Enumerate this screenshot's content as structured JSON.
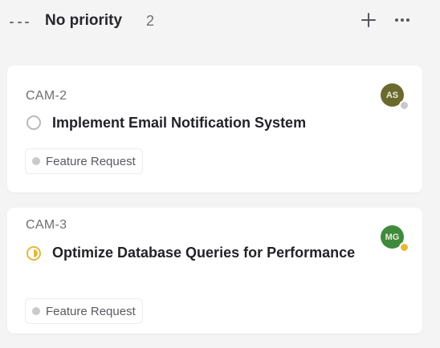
{
  "column": {
    "title": "No priority",
    "count": "2",
    "header_icon": "no-priority-icon",
    "actions": {
      "add_icon": "plus-icon",
      "more_icon": "more-horizontal-icon"
    }
  },
  "cards": [
    {
      "id": "CAM-2",
      "title": "Implement Email Notification System",
      "status_icon": "status-todo-icon",
      "label": "Feature Request",
      "avatar_initials": "AS",
      "avatar_color": "#6b6a2e",
      "presence_color": "#c9c9c9"
    },
    {
      "id": "CAM-3",
      "title": "Optimize Database Queries for Performance",
      "status_icon": "status-in-progress-icon",
      "label": "Feature Request",
      "avatar_initials": "MG",
      "avatar_color": "#3f8a3c",
      "presence_color": "#e2b93b"
    }
  ]
}
